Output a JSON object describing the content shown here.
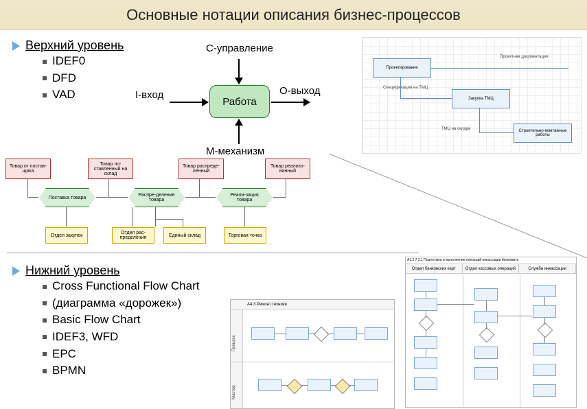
{
  "title": "Основные нотации описания бизнес-процессов",
  "top_level": {
    "heading": "Верхний уровень",
    "items": [
      "IDEF0",
      "DFD",
      "VAD"
    ]
  },
  "idef0": {
    "c": "C-управление",
    "i": "I-вход",
    "o": "O-выход",
    "m": "M-механизм",
    "work": "Работа"
  },
  "topright": {
    "boxes": [
      "Проектирование",
      "Закупка ТМЦ",
      "Строительно-монтажные работы"
    ],
    "labels": [
      "Проектная документация",
      "Спецификации на ТМЦ",
      "ТМЦ на складе"
    ]
  },
  "mid": {
    "pink": [
      "Товар от постав-щика",
      "Товар по-ставленный на склад",
      "Товар распреде-ленный",
      "Товар реализо-ванный"
    ],
    "green": [
      "Поставка товара",
      "Распре-деление товара",
      "Реали-зация товара"
    ],
    "yellow": [
      "Отдел закупок",
      "Отдел рас-пределения",
      "Единый склад",
      "Торговая точка"
    ]
  },
  "bottom_level": {
    "heading": "Нижний уровень",
    "items": [
      "Cross Functional Flow Chart",
      "(диаграмма «дорожек»)",
      "Basic Flow Chart",
      "IDEF3, WFD",
      "EPC",
      "BPMN"
    ]
  },
  "thumb1": {
    "lanes": [
      "Процесс",
      "Мастер"
    ],
    "title": "A4.3 Ремонт техники",
    "cols": [
      "",
      "",
      ""
    ]
  },
  "thumb2": {
    "title": "A1.2.7.2.1 Подготовка и выполнение операций инкассации банкомата",
    "cols": [
      "Отдел банковских карт",
      "Отдел кассовых операций",
      "Служба инкассации"
    ]
  }
}
